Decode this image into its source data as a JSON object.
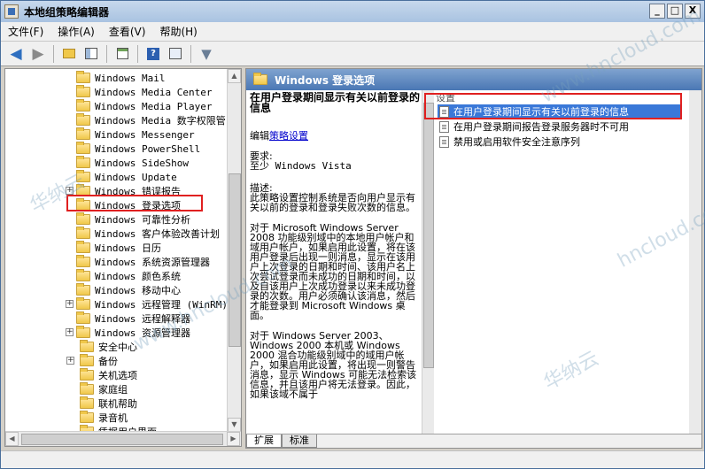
{
  "window": {
    "title": "本地组策略编辑器",
    "controls": [
      "_",
      "□",
      "X"
    ]
  },
  "menu": [
    "文件(F)",
    "操作(A)",
    "查看(V)",
    "帮助(H)"
  ],
  "tree": {
    "items": [
      {
        "label": "Windows Mail",
        "expandable": false
      },
      {
        "label": "Windows Media Center",
        "expandable": false
      },
      {
        "label": "Windows Media Player",
        "expandable": false
      },
      {
        "label": "Windows Media 数字权限管",
        "expandable": false
      },
      {
        "label": "Windows Messenger",
        "expandable": false
      },
      {
        "label": "Windows PowerShell",
        "expandable": false
      },
      {
        "label": "Windows SideShow",
        "expandable": false
      },
      {
        "label": "Windows Update",
        "expandable": false
      },
      {
        "label": "Windows 错误报告",
        "expandable": true
      },
      {
        "label": "Windows 登录选项",
        "expandable": false,
        "selected": true
      },
      {
        "label": "Windows 可靠性分析",
        "expandable": false
      },
      {
        "label": "Windows 客户体验改善计划",
        "expandable": false
      },
      {
        "label": "Windows 日历",
        "expandable": false
      },
      {
        "label": "Windows 系统资源管理器",
        "expandable": false
      },
      {
        "label": "Windows 颜色系统",
        "expandable": false
      },
      {
        "label": "Windows 移动中心",
        "expandable": false
      },
      {
        "label": "Windows 远程管理 (WinRM)",
        "expandable": true
      },
      {
        "label": "Windows 远程解释器",
        "expandable": false
      },
      {
        "label": "Windows 资源管理器",
        "expandable": true
      },
      {
        "label": "安全中心",
        "expandable": false,
        "indent": 1
      },
      {
        "label": "备份",
        "expandable": true,
        "indent": 1
      },
      {
        "label": "关机选项",
        "expandable": false,
        "indent": 1
      },
      {
        "label": "家庭组",
        "expandable": false,
        "indent": 1
      },
      {
        "label": "联机帮助",
        "expandable": false,
        "indent": 1
      },
      {
        "label": "录音机",
        "expandable": false,
        "indent": 1
      },
      {
        "label": "凭据用户界面",
        "expandable": false,
        "indent": 1
      }
    ]
  },
  "right": {
    "header": "Windows 登录选项",
    "desc": {
      "title": "在用户登录期间显示有关以前登录的信息",
      "edit_prefix": "编辑",
      "edit_link": "策略设置",
      "req_label": "要求:",
      "req_value": "至少 Windows Vista",
      "desc_label": "描述:",
      "desc_text": "此策略设置控制系统是否向用户显示有关以前的登录和登录失败次数的信息。",
      "para1": "对于 Microsoft Windows Server 2008 功能级别域中的本地用户帐户和域用户帐户，如果启用此设置，将在该用户登录后出现一则消息，显示在该用户上次登录的日期和时间、该用户名上次尝试登录而未成功的日期和时间，以及自该用户上次成功登录以来未成功登录的次数。用户必须确认该消息，然后才能登录到 Microsoft Windows 桌面。",
      "para2": "对于 Windows Server 2003、Windows 2000 本机或 Windows 2000 混合功能级别域中的域用户帐户，如果启用此设置，将出现一则警告消息，显示 Windows 可能无法检索该信息，并且该用户将无法登录。因此，如果该域不属于"
    },
    "list_header": "设置",
    "settings": [
      "在用户登录期间显示有关以前登录的信息",
      "在用户登录期间报告登录服务器时不可用",
      "禁用或启用软件安全注意序列"
    ],
    "tabs": [
      "扩展",
      "标准"
    ]
  },
  "watermarks": [
    "www.hncloud.com",
    "华纳云",
    "www.hncloud.com",
    "华纳云",
    "hncloud.com"
  ]
}
